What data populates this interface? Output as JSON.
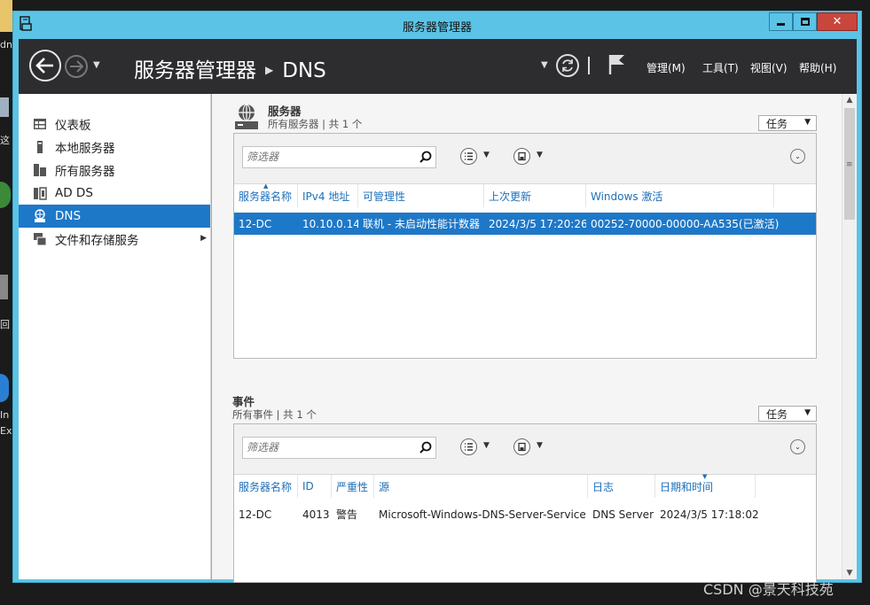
{
  "window": {
    "title": "服务器管理器"
  },
  "desktop": {
    "icon_labels": [
      "dn",
      "这",
      "回",
      "In",
      "Ex"
    ]
  },
  "header": {
    "breadcrumb_root": "服务器管理器",
    "breadcrumb_current": "DNS",
    "menus": [
      "管理(M)",
      "工具(T)",
      "视图(V)",
      "帮助(H)"
    ]
  },
  "sidebar": {
    "items": [
      {
        "label": "仪表板",
        "icon": "dashboard-icon"
      },
      {
        "label": "本地服务器",
        "icon": "local-server-icon"
      },
      {
        "label": "所有服务器",
        "icon": "all-servers-icon"
      },
      {
        "label": "AD DS",
        "icon": "ad-ds-icon"
      },
      {
        "label": "DNS",
        "icon": "dns-icon",
        "active": true
      },
      {
        "label": "文件和存储服务",
        "icon": "file-storage-icon",
        "has_submenu": true
      }
    ]
  },
  "servers": {
    "title": "服务器",
    "subtitle": "所有服务器 | 共 1 个",
    "tasks_label": "任务",
    "filter_placeholder": "筛选器",
    "columns": [
      "服务器名称",
      "IPv4 地址",
      "可管理性",
      "上次更新",
      "Windows 激活"
    ],
    "rows": [
      [
        "12-DC",
        "10.10.0.14",
        "联机 - 未启动性能计数器",
        "2024/3/5 17:20:26",
        "00252-70000-00000-AA535(已激活)"
      ]
    ]
  },
  "events": {
    "title": "事件",
    "subtitle": "所有事件 | 共 1 个",
    "tasks_label": "任务",
    "filter_placeholder": "筛选器",
    "columns": [
      "服务器名称",
      "ID",
      "严重性",
      "源",
      "日志",
      "日期和时间"
    ],
    "rows": [
      [
        "12-DC",
        "4013",
        "警告",
        "Microsoft-Windows-DNS-Server-Service",
        "DNS Server",
        "2024/3/5 17:18:02"
      ]
    ]
  },
  "watermark": "CSDN @景天科技苑",
  "colors": {
    "accent": "#1e78c8",
    "window_border": "#5bc4e6",
    "header_bg": "#2d2d30",
    "close_button": "#c9463d"
  }
}
